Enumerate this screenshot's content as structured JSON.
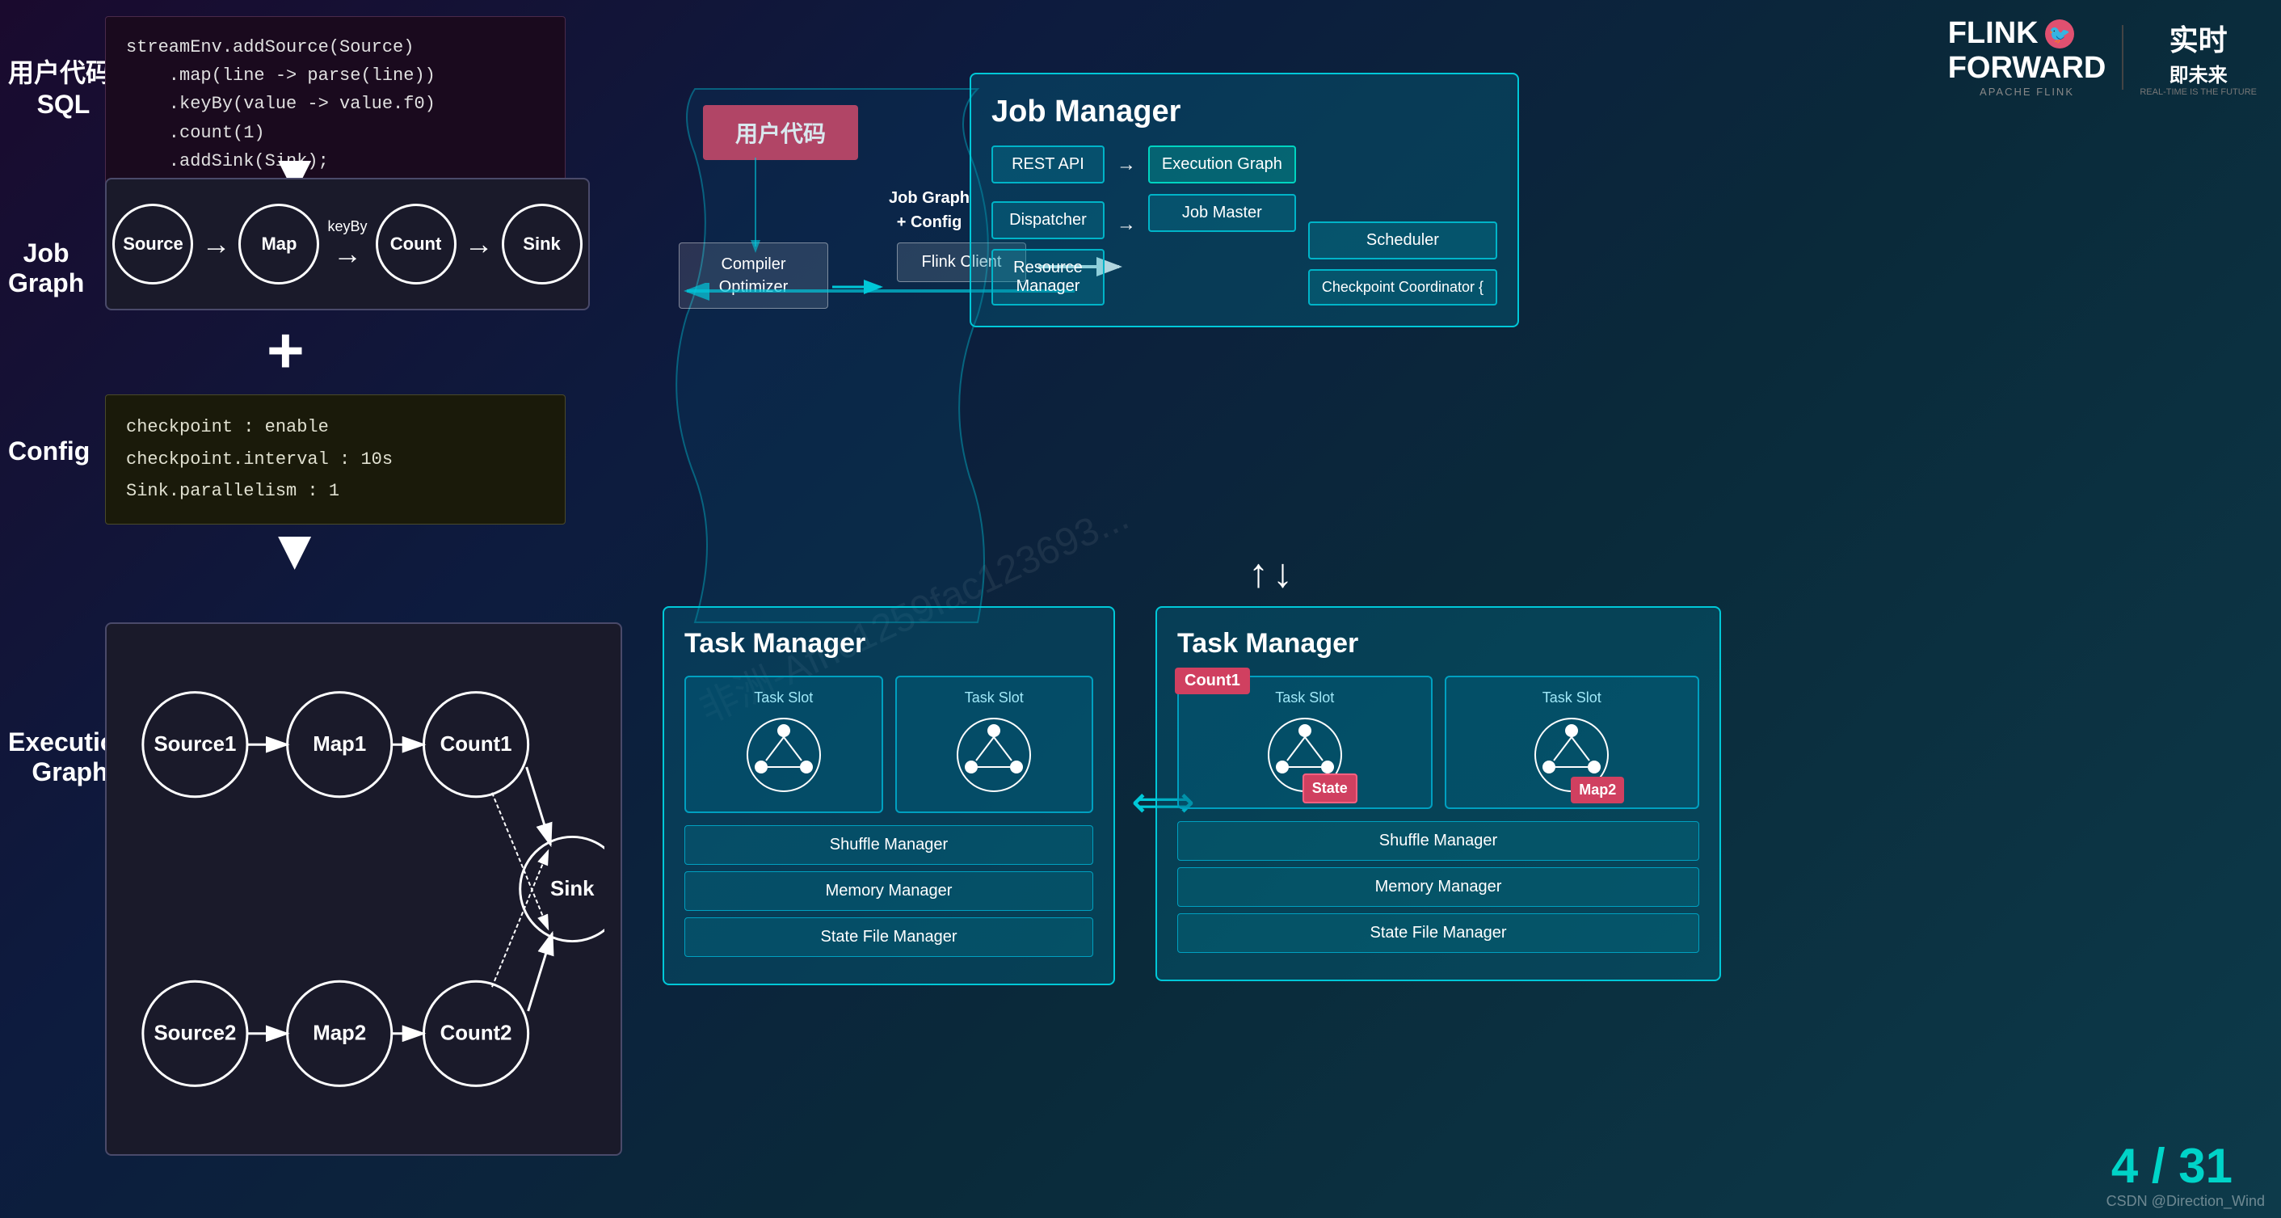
{
  "logos": {
    "flink_forward": "FLINK\nFORWARD",
    "flink_text": "FLINK",
    "forward_text": "FORWARD",
    "apache_text": "APACHE FLINK",
    "second_logo_line1": "实时",
    "second_logo_line2": "即未来",
    "second_logo_sub": "REAL-TIME IS THE FUTURE"
  },
  "left_labels": {
    "user_code": "用户代码/\nSQL",
    "job_graph": "Job\nGraph",
    "config": "Config",
    "execution_graph": "Execution\nGraph"
  },
  "code_box": {
    "code": "streamEnv.addSource(Source)\n    .map(line -> parse(line))\n    .keyBy(value -> value.f0)\n    .count(1)\n    .addSink(Sink);"
  },
  "job_graph_nodes": [
    "Source",
    "Map",
    "Count",
    "Sink"
  ],
  "keyby_label": "keyBy",
  "config_box": {
    "code": "checkpoint : enable\ncheckpoint.interval : 10s\nSink.parallelism : 1"
  },
  "flow_section": {
    "user_code_label": "用户代码",
    "compiler_optimizer": "Compiler\nOptimizer",
    "flink_client": "Flink Client",
    "job_graph_config": "Job Graph\n+ Config"
  },
  "job_manager": {
    "title": "Job Manager",
    "rest_api": "REST API",
    "dispatcher": "Dispatcher",
    "resource_manager": "Resource Manager",
    "execution_graph": "Execution\nGraph",
    "job_master": "Job\nMaster",
    "scheduler": "Scheduler",
    "checkpoint_coordinator": "Checkpoint\nCoordinator {"
  },
  "task_manager_left": {
    "title": "Task Manager",
    "slot1": "Task Slot",
    "slot2": "Task Slot",
    "shuffle_manager": "Shuffle Manager",
    "memory_manager": "Memory Manager",
    "state_file_manager": "State File Manager"
  },
  "task_manager_right": {
    "title": "Task Manager",
    "slot1": "Task Slot",
    "slot2": "Task Slot",
    "shuffle_manager": "Shuffle Manager",
    "memory_manager": "Memory Manager",
    "state_file_manager": "State File Manager",
    "count1_badge": "Count1",
    "map2_badge": "Map2",
    "state_badge": "State"
  },
  "execution_graph_nodes": {
    "source1": "Source1",
    "map1": "Map1",
    "count1": "Count1",
    "sink": "Sink",
    "source2": "Source2",
    "map2": "Map2",
    "count2": "Count2"
  },
  "page_number": "4 / 31",
  "csdn": "CSDN @Direction_Wind",
  "watermark": "非洲-Afric1259fac123693..."
}
